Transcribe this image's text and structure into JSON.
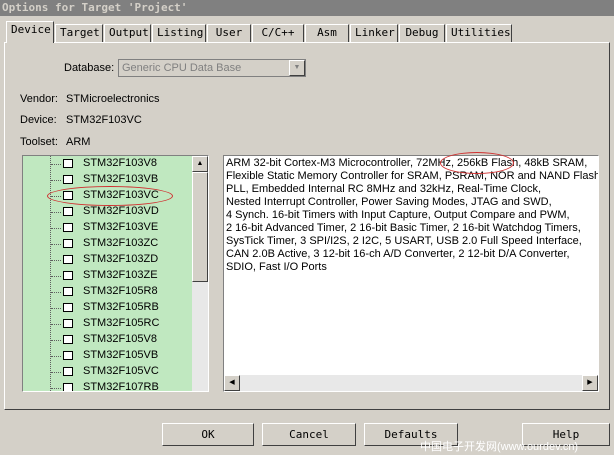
{
  "window": {
    "title": "Options for Target 'Project'"
  },
  "tabs": [
    "Device",
    "Target",
    "Output",
    "Listing",
    "User",
    "C/C++",
    "Asm",
    "Linker",
    "Debug",
    "Utilities"
  ],
  "database": {
    "label": "Database:",
    "value": "Generic CPU Data Base"
  },
  "vendor": {
    "label": "Vendor:",
    "value": "STMicroelectronics"
  },
  "device": {
    "label": "Device:",
    "value": "STM32F103VC"
  },
  "toolset": {
    "label": "Toolset:",
    "value": "ARM"
  },
  "device_list": [
    "STM32F103V8",
    "STM32F103VB",
    "STM32F103VC",
    "STM32F103VD",
    "STM32F103VE",
    "STM32F103ZC",
    "STM32F103ZD",
    "STM32F103ZE",
    "STM32F105R8",
    "STM32F105RB",
    "STM32F105RC",
    "STM32F105V8",
    "STM32F105VB",
    "STM32F105VC",
    "STM32F107RB"
  ],
  "selected_device": "STM32F103VC",
  "description": [
    "ARM 32-bit Cortex-M3 Microcontroller, 72MHz, 256kB Flash, 48kB SRAM,",
    "Flexible Static Memory Controller for SRAM, PSRAM, NOR and NAND Flash,",
    "PLL, Embedded Internal RC 8MHz and 32kHz, Real-Time Clock,",
    "Nested Interrupt Controller, Power Saving Modes, JTAG and SWD,",
    "4 Synch. 16-bit Timers with Input Capture, Output Compare and PWM,",
    "2 16-bit Advanced Timer, 2 16-bit Basic Timer, 2 16-bit Watchdog Timers,",
    "SysTick Timer, 3 SPI/I2S, 2 I2C, 5 USART, USB 2.0 Full Speed Interface,",
    "CAN 2.0B Active, 3 12-bit 16-ch A/D Converter, 2 12-bit D/A Converter,",
    "SDIO, Fast I/O Ports"
  ],
  "buttons": {
    "ok": "OK",
    "cancel": "Cancel",
    "defaults": "Defaults",
    "help": "Help"
  },
  "watermark": "中国电子开发网(www.ourdev.cn)",
  "colors": {
    "list_bg": "#c0e8c0",
    "annotation": "#d03030",
    "dialog_bg": "#d4d0c8"
  }
}
